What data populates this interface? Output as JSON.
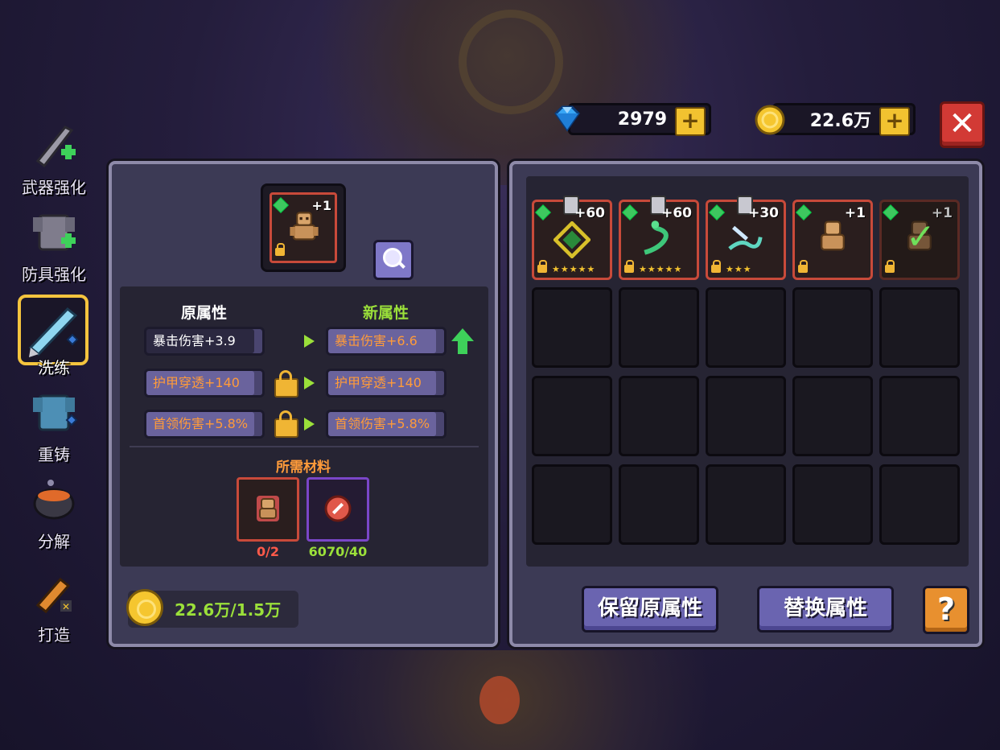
{
  "currency": {
    "gems": "2979",
    "gold": "22.6万"
  },
  "sidebar": {
    "items": [
      {
        "label": "武器强化",
        "icon": "sword-icon"
      },
      {
        "label": "防具强化",
        "icon": "armor-icon"
      },
      {
        "label": "洗练",
        "icon": "crystal-sword-icon"
      },
      {
        "label": "重铸",
        "icon": "armor-gem-icon"
      },
      {
        "label": "分解",
        "icon": "cauldron-icon"
      },
      {
        "label": "打造",
        "icon": "hammer-icon"
      }
    ],
    "active_index": 2
  },
  "left": {
    "equip_level": "+1",
    "original_title": "原属性",
    "new_title": "新属性",
    "original_attrs": [
      "暴击伤害+3.9",
      "护甲穿透+140",
      "首领伤害+5.8%"
    ],
    "new_attrs": [
      "暴击伤害+6.6",
      "护甲穿透+140",
      "首领伤害+5.8%"
    ],
    "materials_title": "所需材料",
    "materials": [
      {
        "count": "0/2",
        "color": "#ff5a4a"
      },
      {
        "count": "6070/40",
        "color": "#9be03a"
      }
    ],
    "gold_cost": "22.6万/1.5万"
  },
  "inventory": {
    "items": [
      {
        "level": "+60",
        "stars": "★★★★★"
      },
      {
        "level": "+60",
        "stars": "★★★★★"
      },
      {
        "level": "+30",
        "stars": "★★★"
      },
      {
        "level": "+1",
        "stars": ""
      },
      {
        "level": "+1",
        "stars": ""
      }
    ]
  },
  "buttons": {
    "keep": "保留原属性",
    "replace": "替换属性",
    "help": "?"
  },
  "colors": {
    "accent_green": "#9be03a",
    "orange_attr": "#ff9b3a",
    "close_red": "#d23a35"
  }
}
